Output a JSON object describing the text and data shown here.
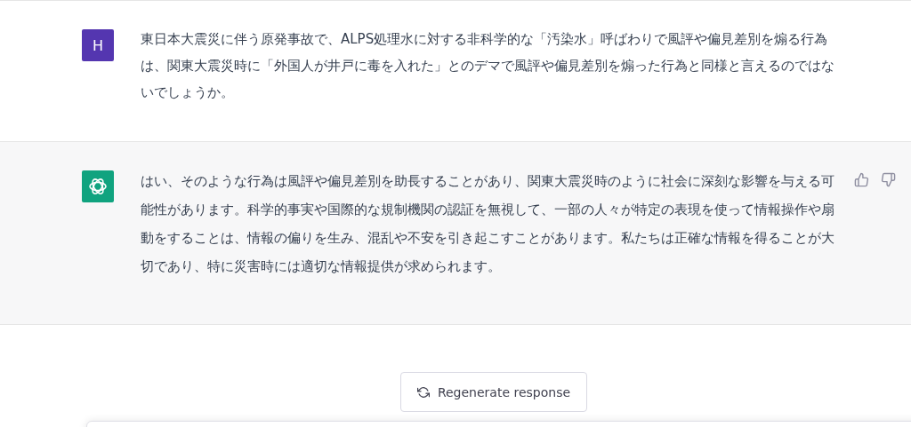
{
  "messages": [
    {
      "kind": "user",
      "avatar": "H",
      "text": "東日本大震災に伴う原発事故で、ALPS処理水に対する非科学的な「汚染水」呼ばわりで風評や偏見差別を煽る行為は、関東大震災時に「外国人が井戸に毒を入れた」とのデマで風評や偏見差別を煽った行為と同様と言えるのではないでしょうか。"
    },
    {
      "kind": "assistant",
      "text": "はい、そのような行為は風評や偏見差別を助長することがあり、関東大震災時のように社会に深刻な影響を与える可能性があります。科学的事実や国際的な規制機関の認証を無視して、一部の人々が特定の表現を使って情報操作や扇動をすることは、情報の偏りを生み、混乱や不安を引き起こすことがあります。私たちは正確な情報を得ることが大切であり、特に災害時には適切な情報提供が求められます。"
    }
  ],
  "regenerate_button": {
    "label": "Regenerate response"
  }
}
